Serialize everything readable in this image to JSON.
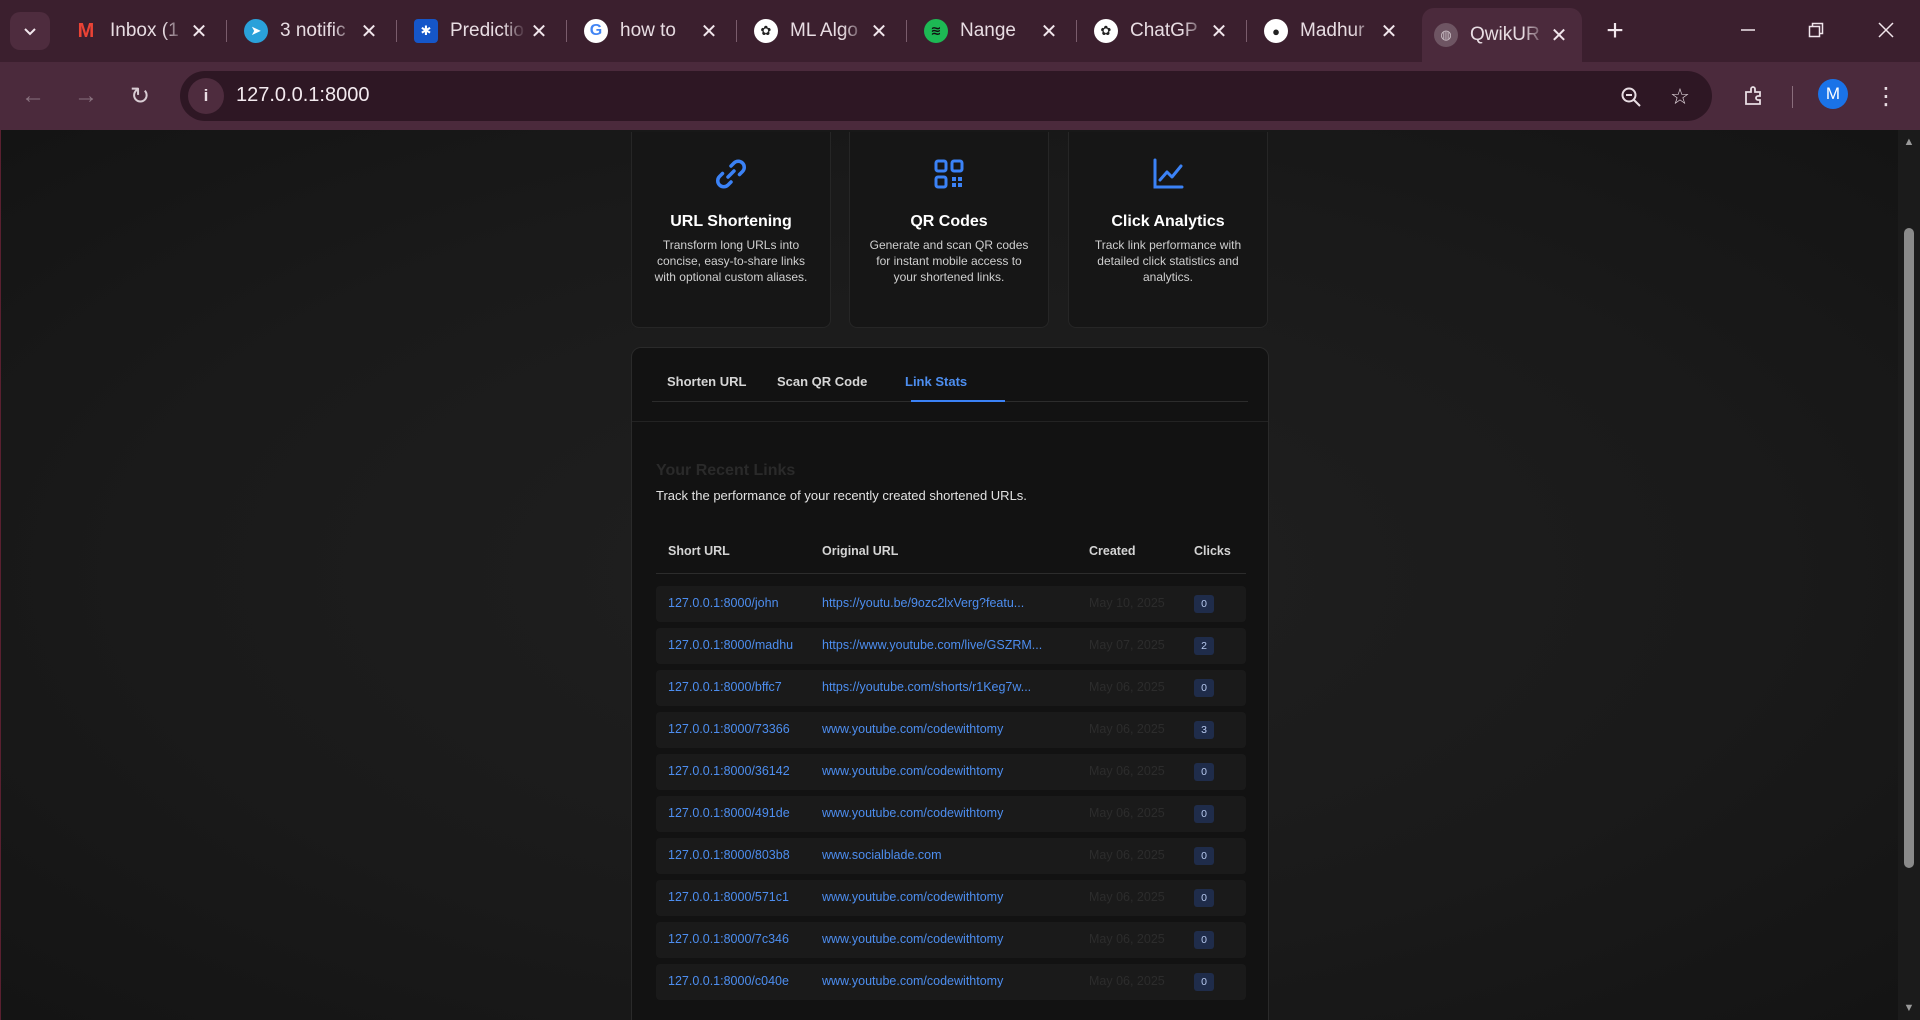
{
  "browser": {
    "tabs": [
      {
        "title": "Inbox (1",
        "icon": "gmail-icon",
        "color": "#ea4335"
      },
      {
        "title": "3 notific",
        "icon": "telegram-icon",
        "color": "#2aa1da"
      },
      {
        "title": "Predictio",
        "icon": "bluesky-icon",
        "color": "#1185fe"
      },
      {
        "title": "how to",
        "icon": "google-icon",
        "color": "#ffffff"
      },
      {
        "title": "ML Algo",
        "icon": "chatgpt-icon",
        "color": "#ffffff"
      },
      {
        "title": "Nange",
        "icon": "spotify-icon",
        "color": "#1db954"
      },
      {
        "title": "ChatGP",
        "icon": "chatgpt-icon",
        "color": "#ffffff"
      },
      {
        "title": "Madhur",
        "icon": "github-icon",
        "color": "#ffffff"
      },
      {
        "title": "QwikUR",
        "icon": "globe-icon",
        "color": "#9aa0a6",
        "active": true
      }
    ],
    "url": "127.0.0.1:8000",
    "profile_initial": "M"
  },
  "features": [
    {
      "title": "URL Shortening",
      "desc": "Transform long URLs into concise, easy-to-share links with optional custom aliases.",
      "icon": "link-icon"
    },
    {
      "title": "QR Codes",
      "desc": "Generate and scan QR codes for instant mobile access to your shortened links.",
      "icon": "qr-code-icon"
    },
    {
      "title": "Click Analytics",
      "desc": "Track link performance with detailed click statistics and analytics.",
      "icon": "chart-line-icon"
    }
  ],
  "panel": {
    "tabs": [
      "Shorten URL",
      "Scan QR Code",
      "Link Stats"
    ],
    "active_tab": "Link Stats",
    "section_title": "Your Recent Links",
    "section_subtitle": "Track the performance of your recently created shortened URLs.",
    "columns": [
      "Short URL",
      "Original URL",
      "Created",
      "Clicks"
    ],
    "rows": [
      {
        "short": "127.0.0.1:8000/john",
        "original": "https://youtu.be/9ozc2lxVerg?featu...",
        "created": "May 10, 2025",
        "clicks": "0"
      },
      {
        "short": "127.0.0.1:8000/madhu",
        "original": "https://www.youtube.com/live/GSZRM...",
        "created": "May 07, 2025",
        "clicks": "2"
      },
      {
        "short": "127.0.0.1:8000/bffc7",
        "original": "https://youtube.com/shorts/r1Keg7w...",
        "created": "May 06, 2025",
        "clicks": "0"
      },
      {
        "short": "127.0.0.1:8000/73366",
        "original": "www.youtube.com/codewithtomy",
        "created": "May 06, 2025",
        "clicks": "3"
      },
      {
        "short": "127.0.0.1:8000/36142",
        "original": "www.youtube.com/codewithtomy",
        "created": "May 06, 2025",
        "clicks": "0"
      },
      {
        "short": "127.0.0.1:8000/491de",
        "original": "www.youtube.com/codewithtomy",
        "created": "May 06, 2025",
        "clicks": "0"
      },
      {
        "short": "127.0.0.1:8000/803b8",
        "original": "www.socialblade.com",
        "created": "May 06, 2025",
        "clicks": "0"
      },
      {
        "short": "127.0.0.1:8000/571c1",
        "original": "www.youtube.com/codewithtomy",
        "created": "May 06, 2025",
        "clicks": "0"
      },
      {
        "short": "127.0.0.1:8000/7c346",
        "original": "www.youtube.com/codewithtomy",
        "created": "May 06, 2025",
        "clicks": "0"
      },
      {
        "short": "127.0.0.1:8000/c040e",
        "original": "www.youtube.com/codewithtomy",
        "created": "May 06, 2025",
        "clicks": "0"
      }
    ]
  },
  "colors": {
    "accent": "#3b82f6",
    "chrome": "#3b1f2e"
  }
}
